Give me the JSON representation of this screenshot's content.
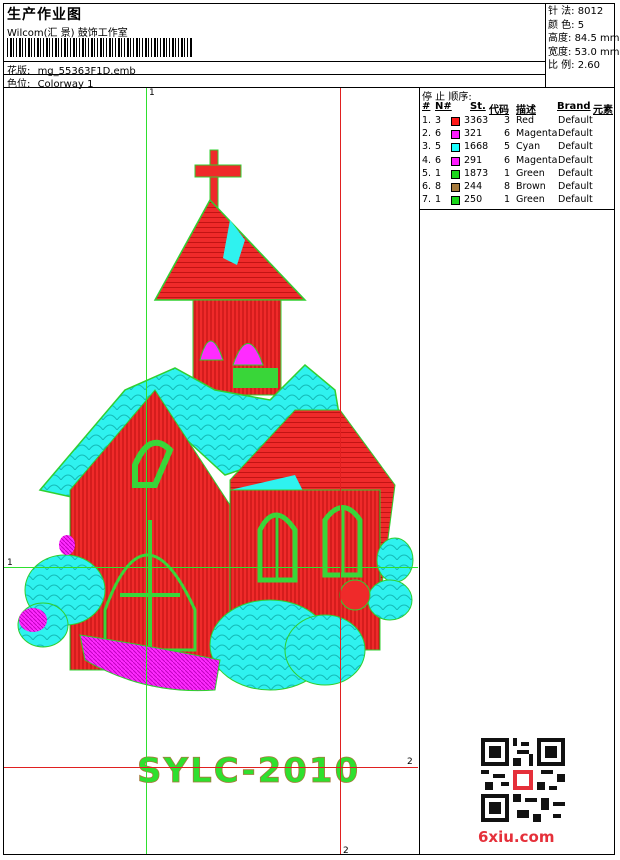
{
  "header": {
    "title": "生产作业图",
    "company": "Wilcom(汇 景) 鼓饰工作室",
    "design_label": "花版:",
    "design_value": "mg_55363F1D.emb",
    "colorway_label": "色位:",
    "colorway_value": "Colorway 1"
  },
  "stats": [
    {
      "label": "针 法:",
      "value": "8012"
    },
    {
      "label": "颜 色:",
      "value": "5"
    },
    {
      "label": "高度:",
      "value": "84.5 mm"
    },
    {
      "label": "宽度:",
      "value": "53.0 mm"
    },
    {
      "label": "比 例:",
      "value": "2.60"
    }
  ],
  "stop_sequence": {
    "title": "停 止 顺序:",
    "headers": [
      "#",
      "N#",
      "St.",
      "代码",
      "描述",
      "Brand",
      "元素"
    ],
    "rows": [
      {
        "index": "1.",
        "n": "3",
        "stitches": "3363",
        "code": "3",
        "desc": "Red",
        "brand": "Default",
        "color": "#ff1a1a"
      },
      {
        "index": "2.",
        "n": "6",
        "stitches": "321",
        "code": "6",
        "desc": "Magenta",
        "brand": "Default",
        "color": "#ff1aff"
      },
      {
        "index": "3.",
        "n": "5",
        "stitches": "1668",
        "code": "5",
        "desc": "Cyan",
        "brand": "Default",
        "color": "#1affff"
      },
      {
        "index": "4.",
        "n": "6",
        "stitches": "291",
        "code": "6",
        "desc": "Magenta",
        "brand": "Default",
        "color": "#ff1aff"
      },
      {
        "index": "5.",
        "n": "1",
        "stitches": "1873",
        "code": "1",
        "desc": "Green",
        "brand": "Default",
        "color": "#1ad61a"
      },
      {
        "index": "6.",
        "n": "8",
        "stitches": "244",
        "code": "8",
        "desc": "Brown",
        "brand": "Default",
        "color": "#a57a3c"
      },
      {
        "index": "7.",
        "n": "1",
        "stitches": "250",
        "code": "1",
        "desc": "Green",
        "brand": "Default",
        "color": "#1ad61a"
      }
    ]
  },
  "guides": {
    "v1": "1",
    "h1": "1",
    "v2": "2",
    "h2": "2"
  },
  "design": {
    "caption": "SYLC-2010"
  },
  "watermark": {
    "site": "6xiu.com"
  }
}
